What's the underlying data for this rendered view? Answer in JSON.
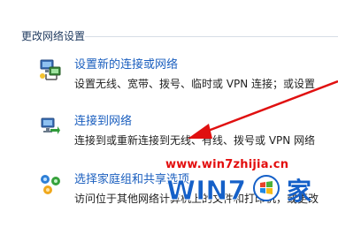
{
  "section": {
    "title": "更改网络设置"
  },
  "items": [
    {
      "link": "设置新的连接或网络",
      "description": "设置无线、宽带、拨号、临时或 VPN 连接；或设置",
      "icon": "network-setup-icon"
    },
    {
      "link": "连接到网络",
      "description": "连接到或重新连接到无线、有线、拨号或 VPN 网络",
      "icon": "connect-network-icon"
    },
    {
      "link": "选择家庭组和共享选项",
      "description": "访问位于其他网络计算机上的文件和打印机，或更改",
      "icon": "homegroup-icon"
    }
  ],
  "watermark": {
    "url": "www.win7zhijia.cn",
    "logo_text": "WIN7",
    "logo_char": "家"
  },
  "colors": {
    "link": "#1b5fbf",
    "arrow": "#e01010",
    "watermark": "#e30e0e",
    "logo_blue": "#1560c8"
  }
}
